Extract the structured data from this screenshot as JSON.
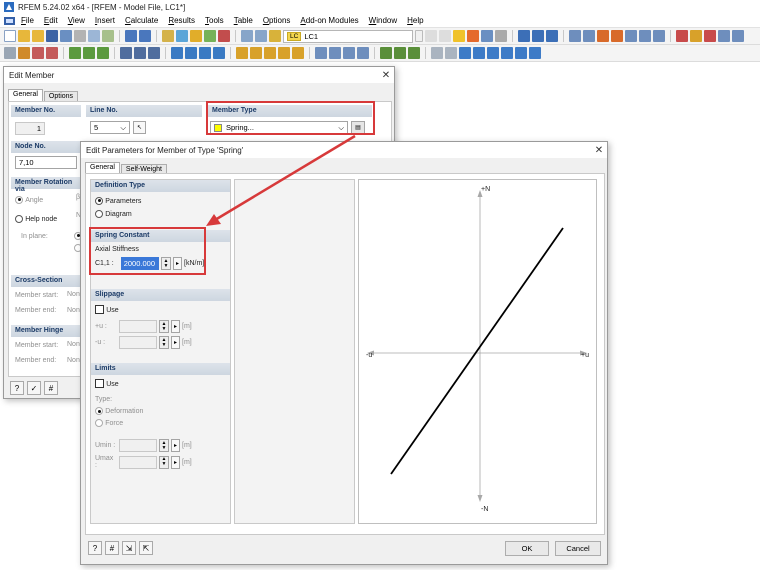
{
  "app": {
    "title": "RFEM 5.24.02 x64 - [RFEM - Model File, LC1*]",
    "menu": [
      "File",
      "Edit",
      "View",
      "Insert",
      "Calculate",
      "Results",
      "Tools",
      "Table",
      "Options",
      "Add-on Modules",
      "Window",
      "Help"
    ],
    "lc_combo": {
      "tag": "LC",
      "value": "LC1"
    }
  },
  "edit_member": {
    "title": "Edit Member",
    "tabs": [
      "General",
      "Options"
    ],
    "member_no": {
      "label": "Member No.",
      "value": "1"
    },
    "line_no": {
      "label": "Line No.",
      "value": "5"
    },
    "member_type": {
      "label": "Member Type",
      "value": "Spring..."
    },
    "node_no": {
      "label": "Node No.",
      "value": "7,10"
    },
    "rotation": {
      "label": "Member Rotation via",
      "angle": "Angle",
      "angle_trunc": "β:",
      "help_node": "Help node",
      "help_trunc": "N",
      "in_plane": "In plane:"
    },
    "cross_section": {
      "label": "Cross-Section",
      "start": "Member start:",
      "end": "Member end:",
      "start_val": "Non",
      "end_val": "Non"
    },
    "hinge": {
      "label": "Member Hinge",
      "start": "Member start:",
      "end": "Member end:",
      "start_val": "Non",
      "end_val": "Non"
    }
  },
  "spring_dialog": {
    "title": "Edit Parameters for Member of Type 'Spring'",
    "tabs": [
      "General",
      "Self-Weight"
    ],
    "definition_type": {
      "label": "Definition Type",
      "options": [
        "Parameters",
        "Diagram"
      ],
      "selected": "Parameters"
    },
    "spring_constant": {
      "label": "Spring Constant",
      "sub": "Axial Stiffness",
      "symbol": "C1,1 :",
      "value": "2000.000",
      "unit": "[kN/m]"
    },
    "slippage": {
      "label": "Slippage",
      "use": "Use",
      "sym1": "+u :",
      "sym2": "-u :",
      "unit": "[m]"
    },
    "limits": {
      "label": "Limits",
      "use": "Use",
      "type_label": "Type:",
      "type_options": [
        "Deformation",
        "Force"
      ],
      "umin": "Umin :",
      "umax": "Umax :",
      "unit": "[m]"
    },
    "diagram": {
      "pos_n": "+N",
      "neg_n": "-N",
      "pos_u": "+u",
      "neg_u": "-u"
    },
    "ok": "OK",
    "cancel": "Cancel"
  },
  "colors": {
    "highlight": "#d7393a",
    "member_type_swatch": "#ffff00",
    "group_header": "#1b3a66"
  }
}
